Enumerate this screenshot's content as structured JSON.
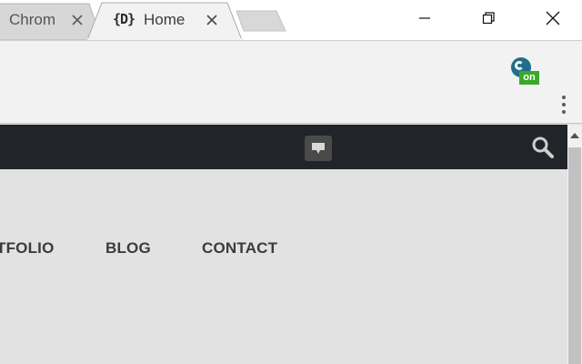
{
  "browser": {
    "tabs": [
      {
        "label": "Chrom",
        "active": false
      },
      {
        "label": "Home",
        "favicon_text": "{D}",
        "active": true
      }
    ],
    "window_controls": [
      "minimize-icon",
      "restore-icon",
      "close-icon"
    ]
  },
  "toolbar": {
    "extension_badge": "on",
    "extension_icon": "chat-extension-icon",
    "menu_icon": "kebab-menu-icon"
  },
  "site": {
    "header_icons": [
      "chat-bubble-icon",
      "search-icon"
    ],
    "nav": [
      "TFOLIO",
      "BLOG",
      "CONTACT"
    ]
  },
  "colors": {
    "site_bar": "#212529",
    "page_bg": "#e2e2e2",
    "badge_green": "#3aa829",
    "extension_blue": "#1f6f8b"
  }
}
